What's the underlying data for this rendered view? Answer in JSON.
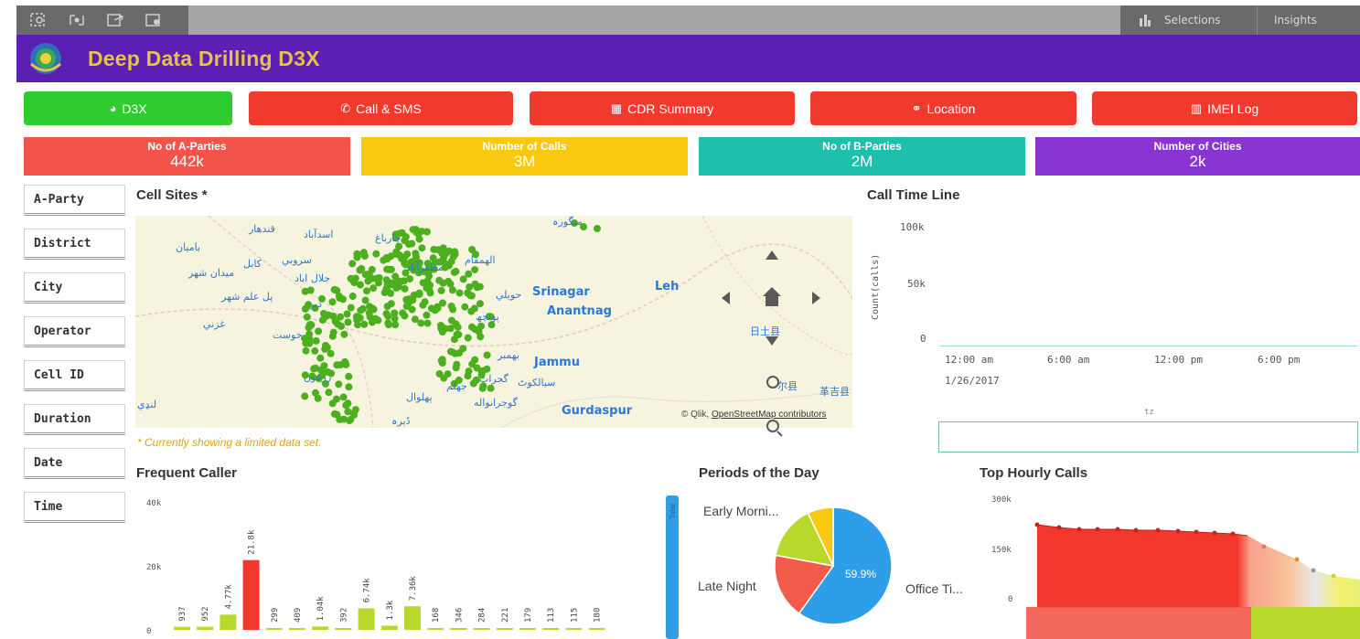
{
  "toolbar": {
    "selections_label": "Selections",
    "insights_label": "Insights"
  },
  "app": {
    "title": "Deep Data Drilling D3X"
  },
  "nav": [
    {
      "label": "D3X",
      "icon": "dashboard-icon",
      "color": "#2fcc2f"
    },
    {
      "label": "Call & SMS",
      "icon": "phone-icon",
      "color": "#f03a2d"
    },
    {
      "label": "CDR Summary",
      "icon": "calendar-icon",
      "color": "#f03a2d"
    },
    {
      "label": "Location",
      "icon": "link-icon",
      "color": "#f03a2d"
    },
    {
      "label": "IMEI Log",
      "icon": "bar-chart-icon",
      "color": "#f03a2d"
    }
  ],
  "kpis": [
    {
      "title": "No of A-Parties",
      "value": "442k",
      "color": "#f2544a"
    },
    {
      "title": "Number of Calls",
      "value": "3M",
      "color": "#f9c912"
    },
    {
      "title": "No of B-Parties",
      "value": "2M",
      "color": "#1fbfad"
    },
    {
      "title": "Number of Cities",
      "value": "2k",
      "color": "#8a35d1"
    }
  ],
  "filters": [
    "A-Party",
    "District",
    "City",
    "Operator",
    "Cell ID",
    "Duration",
    "Date",
    "Time"
  ],
  "cell_sites": {
    "title": "Cell Sites *",
    "note": "* Currently showing a limited data set.",
    "attribution_prefix": "© Qlik, ",
    "attribution_link": "OpenStreetMap contributors",
    "labels_urdu": [
      "باميان",
      "قندهار",
      "اسدآباد",
      "سروبي",
      "كابل",
      "ميدان شهر",
      "جلال اباد",
      "پل علم شهر",
      "غزني",
      "خوست",
      "دېر",
      "الهمقام",
      "چارباغ",
      "حويلي",
      "مظفرآباد",
      "پونچھ",
      "بهمبر",
      "گجرات",
      "سيالكوٹ",
      "جهلم",
      "گوجرانواله",
      "پهلوال",
      "ڈيرہ",
      "لنډي",
      "زرغون",
      "منگورہ"
    ],
    "labels_en": [
      "Srinagar",
      "Anantnag",
      "Leh",
      "Jammu",
      "Gurdaspur"
    ],
    "labels_cn": [
      "日土县",
      "尔县",
      "革吉县"
    ]
  },
  "timeline": {
    "title": "Call Time Line",
    "ylabel": "Count(calls)",
    "yticks": [
      "100k",
      "50k",
      "0"
    ],
    "xticks": [
      "12:00 am",
      "6:00 am",
      "12:00 pm",
      "6:00 pm"
    ],
    "date": "1/26/2017",
    "scroll_label": "tz"
  },
  "frequent_caller": {
    "title": "Frequent Caller",
    "chart_data": {
      "type": "bar",
      "yticks": [
        "40k",
        "20k",
        "0"
      ],
      "ylim": [
        0,
        40000
      ],
      "values": [
        937,
        952,
        4770,
        21800,
        299,
        409,
        1040,
        392,
        6740,
        1300,
        7360,
        168,
        346,
        284,
        221,
        179,
        113,
        115,
        180
      ],
      "labels": [
        "937",
        "952",
        "4.77k",
        "21.8k",
        "299",
        "409",
        "1.04k",
        "392",
        "6.74k",
        "1.3k",
        "7.36k",
        "168",
        "346",
        "284",
        "221",
        "179",
        "113",
        "115",
        "180"
      ],
      "highlight_index": 3,
      "scroll_label": "Total"
    }
  },
  "periods": {
    "title": "Periods of the Day",
    "chart_data": {
      "type": "pie",
      "slices": [
        {
          "label": "Office Ti...",
          "value": 59.9,
          "color": "#2e9ee8"
        },
        {
          "label": "Late Night",
          "value": 18.0,
          "color": "#f25a4a"
        },
        {
          "label": "Early Morni...",
          "value": 15.0,
          "color": "#b8d82c"
        },
        {
          "label": "",
          "value": 7.1,
          "color": "#f9c912"
        }
      ],
      "data_label": "59.9%"
    }
  },
  "top_hourly": {
    "title": "Top Hourly Calls",
    "yticks": [
      "300k",
      "150k",
      "0"
    ]
  }
}
